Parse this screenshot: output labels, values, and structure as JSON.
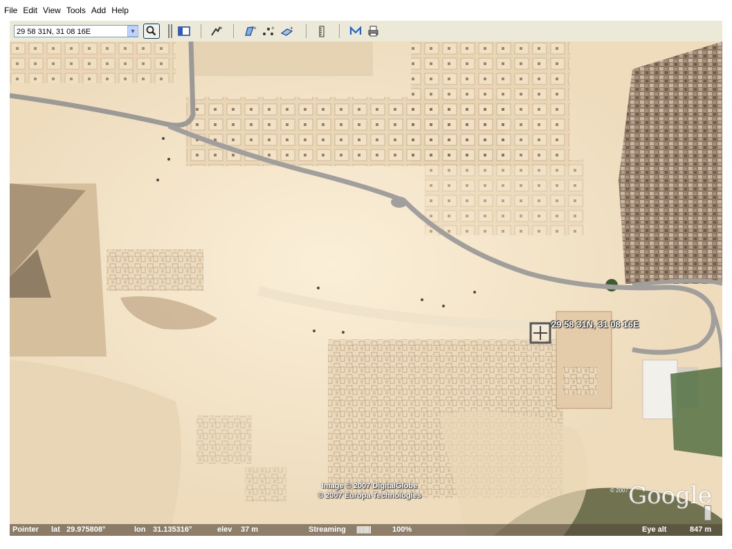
{
  "menu": {
    "items": [
      "File",
      "Edit",
      "View",
      "Tools",
      "Add",
      "Help"
    ]
  },
  "toolbar": {
    "search_value": "29 58 31N, 31 08 16E",
    "icons": [
      "sidebar-toggle-icon",
      "placemark-icon",
      "polygon-icon",
      "path-icon",
      "image-overlay-icon",
      "ruler-icon",
      "email-icon",
      "print-icon"
    ]
  },
  "map": {
    "coordinate_label": "29 58 31N, 31 08 16E",
    "copyright_line1": "Image © 2007 DigitalGlobe",
    "copyright_line2": "© 2007 Europa Technologies",
    "logo_text": "Google",
    "logo_small": "© 2007"
  },
  "status": {
    "pointer_label": "Pointer",
    "lat_label": "lat",
    "lat_value": "29.975808°",
    "lon_label": "lon",
    "lon_value": "31.135316°",
    "elev_label": "elev",
    "elev_value": "37 m",
    "streaming_label": "Streaming",
    "streaming_bar": "||||||||||",
    "streaming_percent": "100%",
    "eye_alt_label": "Eye alt",
    "eye_alt_value": "847 m"
  }
}
